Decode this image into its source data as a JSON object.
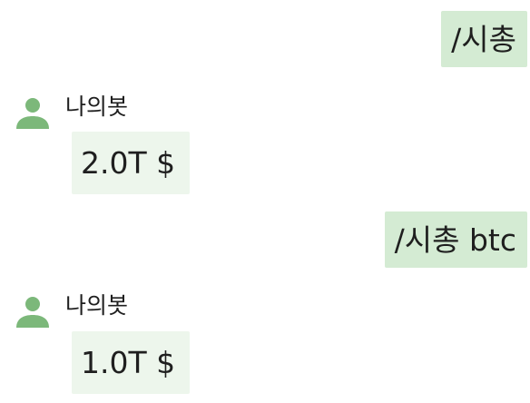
{
  "colors": {
    "outgoing_bubble": "#d4ebd3",
    "incoming_bubble": "#edf6ec",
    "avatar": "#7cb87a"
  },
  "messages": [
    {
      "direction": "outgoing",
      "text": "/시총"
    },
    {
      "direction": "incoming",
      "sender": "나의봇",
      "avatar_icon": "user-avatar-icon",
      "text": "2.0T $"
    },
    {
      "direction": "outgoing",
      "text": "/시총 btc"
    },
    {
      "direction": "incoming",
      "sender": "나의봇",
      "avatar_icon": "user-avatar-icon",
      "text": "1.0T $"
    }
  ]
}
